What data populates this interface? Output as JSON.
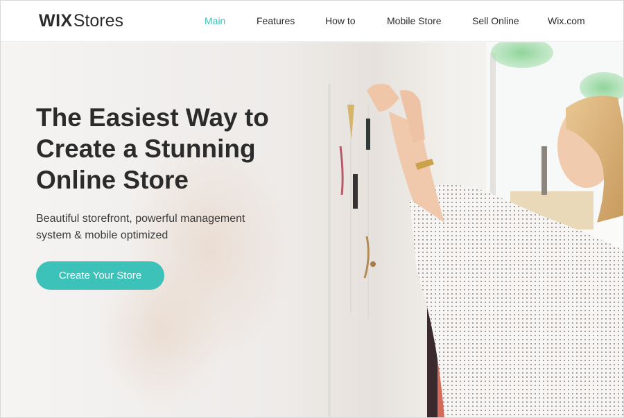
{
  "brand": {
    "logo_wix": "WIX",
    "logo_stores": "Stores"
  },
  "nav": {
    "items": [
      {
        "label": "Main",
        "active": true
      },
      {
        "label": "Features",
        "active": false
      },
      {
        "label": "How to",
        "active": false
      },
      {
        "label": "Mobile Store",
        "active": false
      },
      {
        "label": "Sell Online",
        "active": false
      },
      {
        "label": "Wix.com",
        "active": false
      }
    ]
  },
  "hero": {
    "title_line1": "The Easiest Way to",
    "title_line2": "Create a Stunning",
    "title_line3": "Online Store",
    "subtitle_line1": "Beautiful storefront, powerful management",
    "subtitle_line2": "system & mobile optimized",
    "cta_label": "Create Your Store"
  },
  "colors": {
    "accent": "#3cc2b8",
    "text": "#2b2b2b",
    "header_bg": "#ffffff"
  }
}
